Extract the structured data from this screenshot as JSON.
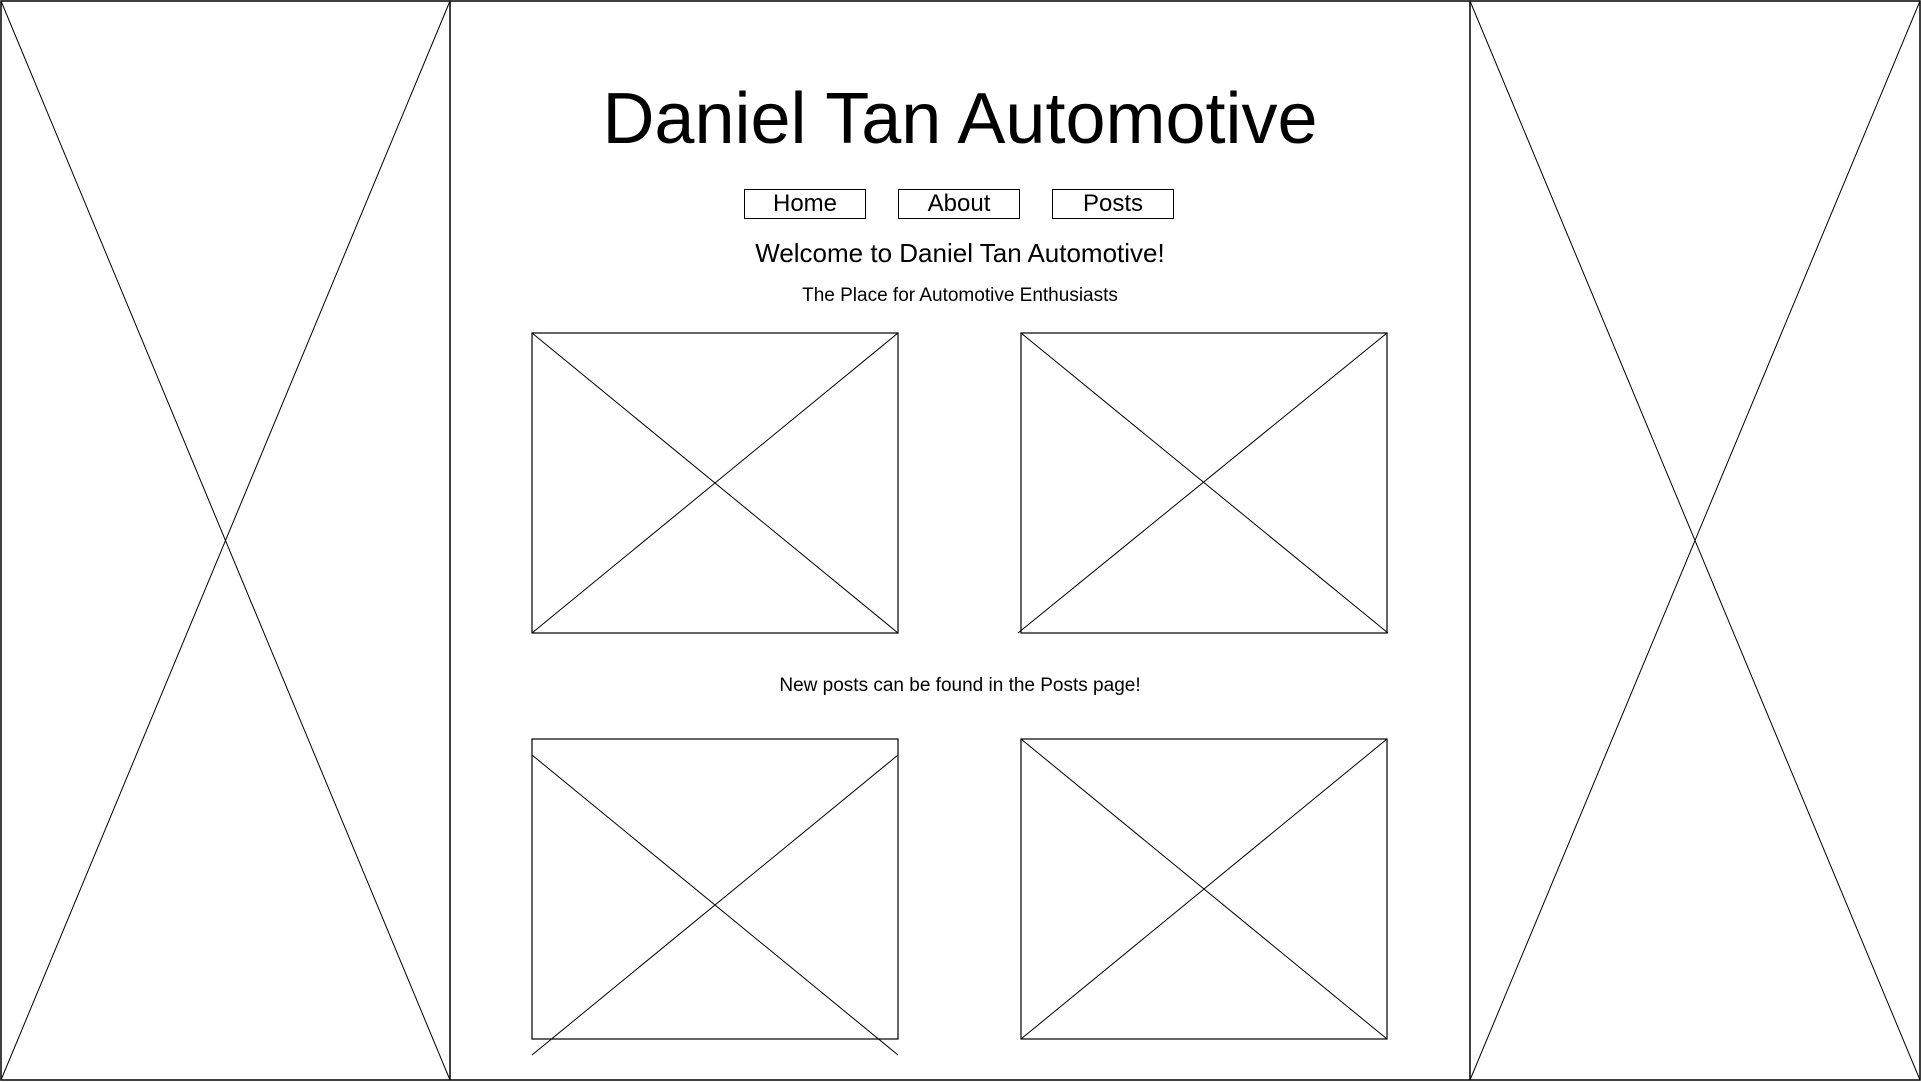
{
  "header": {
    "title": "Daniel Tan Automotive"
  },
  "nav": {
    "home_label": "Home",
    "about_label": "About",
    "posts_label": "Posts"
  },
  "main": {
    "welcome": "Welcome to Daniel Tan Automotive!",
    "tagline": "The Place for Automotive Enthusiasts",
    "posts_note": "New posts can be found in the Posts page!"
  },
  "colors": {
    "line": "#000000",
    "background": "#ffffff"
  }
}
